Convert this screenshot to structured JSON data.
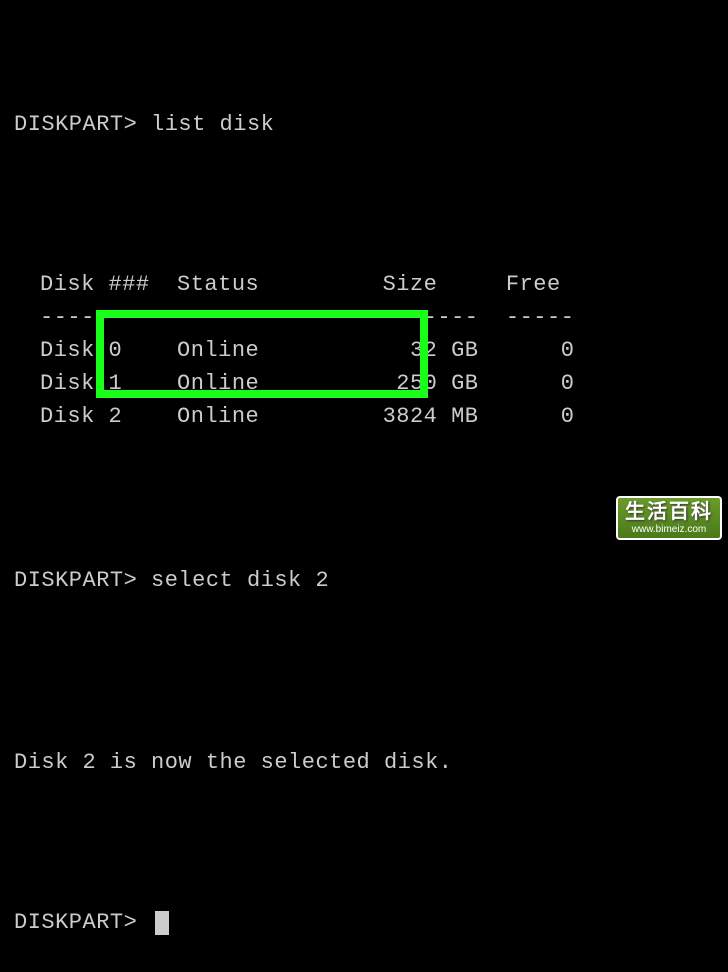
{
  "prompt": "DISKPART>",
  "commands": {
    "list": "list disk",
    "select": "select disk 2"
  },
  "table": {
    "headers": {
      "disk": "Disk ###",
      "status": "Status",
      "size": "Size",
      "free": "Free"
    },
    "dividers": {
      "disk": "--------",
      "status": "-------------",
      "size": "-------",
      "free": "-----"
    },
    "rows": [
      {
        "disk": "Disk 0",
        "status": "Online",
        "size": "32 GB",
        "free": "0"
      },
      {
        "disk": "Disk 1",
        "status": "Online",
        "size": "250 GB",
        "free": "0"
      },
      {
        "disk": "Disk 2",
        "status": "Online",
        "size": "3824 MB",
        "free": "0"
      }
    ]
  },
  "response": "Disk 2 is now the selected disk.",
  "watermark": {
    "title": "生活百科",
    "url": "www.bimeiz.com"
  }
}
